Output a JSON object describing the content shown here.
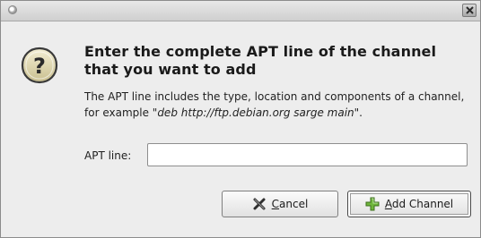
{
  "window": {
    "controls": {
      "menu_icon": "window-menu-icon",
      "close_icon": "close-icon"
    }
  },
  "dialog": {
    "icon": "question-icon",
    "heading": "Enter the complete APT line of the channel that you want to add",
    "description": {
      "prefix": "The APT line includes the type, location and components of a channel, for example \"",
      "example": "deb http://ftp.debian.org sarge main",
      "suffix": "\"."
    },
    "apt_field": {
      "label": "APT line:",
      "value": ""
    }
  },
  "buttons": {
    "cancel": {
      "label_mnemonic": "C",
      "label_rest": "ancel",
      "icon": "cancel-x-icon"
    },
    "add": {
      "label_mnemonic": "A",
      "label_rest": "dd Channel",
      "icon": "add-plus-icon"
    }
  },
  "colors": {
    "titlebar": "#cfcfcf",
    "dialog_bg": "#ededed",
    "add_icon_green": "#5aa12e"
  }
}
